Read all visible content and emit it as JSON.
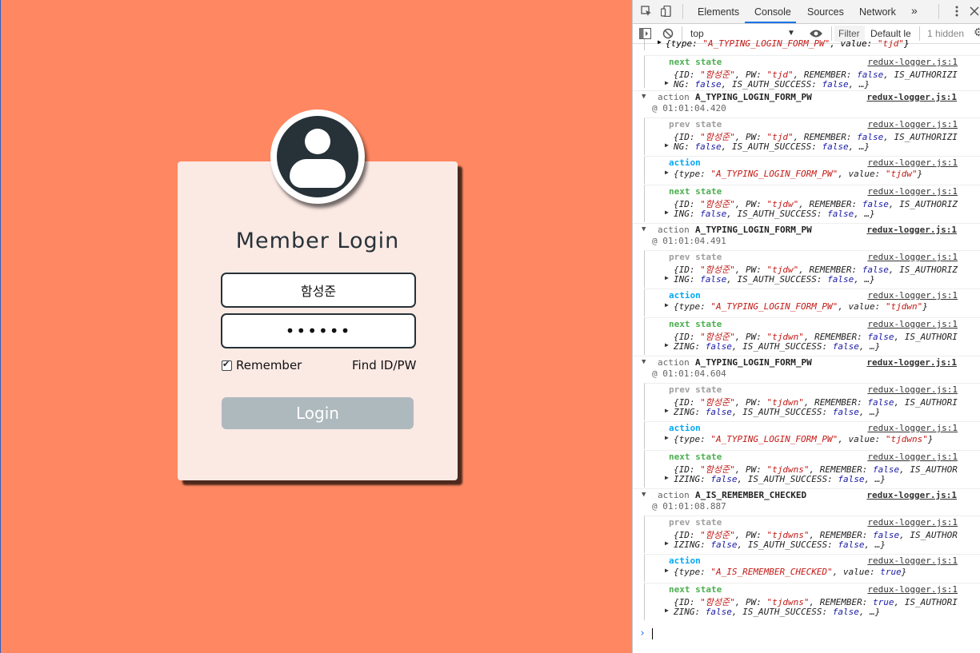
{
  "login": {
    "title": "Member Login",
    "id_value": "함성준",
    "pw_value": "••••••",
    "remember_label": "Remember",
    "remember_checked": true,
    "find_label": "Find ID/PW",
    "login_label": "Login",
    "colors": {
      "background": "#ff8761",
      "card": "#fbe9e4",
      "button": "#aeb9be",
      "dark": "#263238"
    }
  },
  "devtools": {
    "tabs": [
      "Elements",
      "Console",
      "Sources",
      "Network"
    ],
    "active_tab": "Console",
    "more": "»",
    "context": "top",
    "filter_placeholder": "Filter",
    "levels": "Default le",
    "hidden": "1 hidden",
    "top_partial": "{type: \"A_TYPING_LOGIN_FORM_PW\", value: \"tjd\"}",
    "first_next": {
      "label": "next state",
      "src": "redux-logger.js:1",
      "line1": "{ID: \"함성준\", PW: \"tjd\", REMEMBER: false, IS_AUTHORIZI",
      "line2": "NG: false, IS_AUTH_SUCCESS: false, …}"
    },
    "groups": [
      {
        "action_word": "action",
        "action_name": "A_TYPING_LOGIN_FORM_PW",
        "time": "@ 01:01:04.420",
        "src": "redux-logger.js:1",
        "prev": {
          "label": "prev state",
          "src": "redux-logger.js:1",
          "line1": "{ID: \"함성준\", PW: \"tjd\", REMEMBER: false, IS_AUTHORIZI",
          "line2": "NG: false, IS_AUTH_SUCCESS: false, …}"
        },
        "act": {
          "label": "action",
          "src": "redux-logger.js:1",
          "line1": "{type: \"A_TYPING_LOGIN_FORM_PW\", value: \"tjdw\"}"
        },
        "next": {
          "label": "next state",
          "src": "redux-logger.js:1",
          "line1": "{ID: \"함성준\", PW: \"tjdw\", REMEMBER: false, IS_AUTHORIZ",
          "line2": "ING: false, IS_AUTH_SUCCESS: false, …}"
        }
      },
      {
        "action_word": "action",
        "action_name": "A_TYPING_LOGIN_FORM_PW",
        "time": "@ 01:01:04.491",
        "src": "redux-logger.js:1",
        "prev": {
          "label": "prev state",
          "src": "redux-logger.js:1",
          "line1": "{ID: \"함성준\", PW: \"tjdw\", REMEMBER: false, IS_AUTHORIZ",
          "line2": "ING: false, IS_AUTH_SUCCESS: false, …}"
        },
        "act": {
          "label": "action",
          "src": "redux-logger.js:1",
          "line1": "{type: \"A_TYPING_LOGIN_FORM_PW\", value: \"tjdwn\"}"
        },
        "next": {
          "label": "next state",
          "src": "redux-logger.js:1",
          "line1": "{ID: \"함성준\", PW: \"tjdwn\", REMEMBER: false, IS_AUTHORI",
          "line2": "ZING: false, IS_AUTH_SUCCESS: false, …}"
        }
      },
      {
        "action_word": "action",
        "action_name": "A_TYPING_LOGIN_FORM_PW",
        "time": "@ 01:01:04.604",
        "src": "redux-logger.js:1",
        "prev": {
          "label": "prev state",
          "src": "redux-logger.js:1",
          "line1": "{ID: \"함성준\", PW: \"tjdwn\", REMEMBER: false, IS_AUTHORI",
          "line2": "ZING: false, IS_AUTH_SUCCESS: false, …}"
        },
        "act": {
          "label": "action",
          "src": "redux-logger.js:1",
          "line1": "{type: \"A_TYPING_LOGIN_FORM_PW\", value: \"tjdwns\"}"
        },
        "next": {
          "label": "next state",
          "src": "redux-logger.js:1",
          "line1": "{ID: \"함성준\", PW: \"tjdwns\", REMEMBER: false, IS_AUTHOR",
          "line2": "IZING: false, IS_AUTH_SUCCESS: false, …}"
        }
      },
      {
        "action_word": "action",
        "action_name": "A_IS_REMEMBER_CHECKED",
        "time": "@ 01:01:08.887",
        "src": "redux-logger.js:1",
        "prev": {
          "label": "prev state",
          "src": "redux-logger.js:1",
          "line1": "{ID: \"함성준\", PW: \"tjdwns\", REMEMBER: false, IS_AUTHOR",
          "line2": "IZING: false, IS_AUTH_SUCCESS: false, …}"
        },
        "act": {
          "label": "action",
          "src": "redux-logger.js:1",
          "line1": "{type: \"A_IS_REMEMBER_CHECKED\", value: true}"
        },
        "next": {
          "label": "next state",
          "src": "redux-logger.js:1",
          "line1": "{ID: \"함성준\", PW: \"tjdwns\", REMEMBER: true, IS_AUTHORI",
          "line2": "ZING: false, IS_AUTH_SUCCESS: false, …}"
        }
      }
    ],
    "prompt": "›"
  }
}
